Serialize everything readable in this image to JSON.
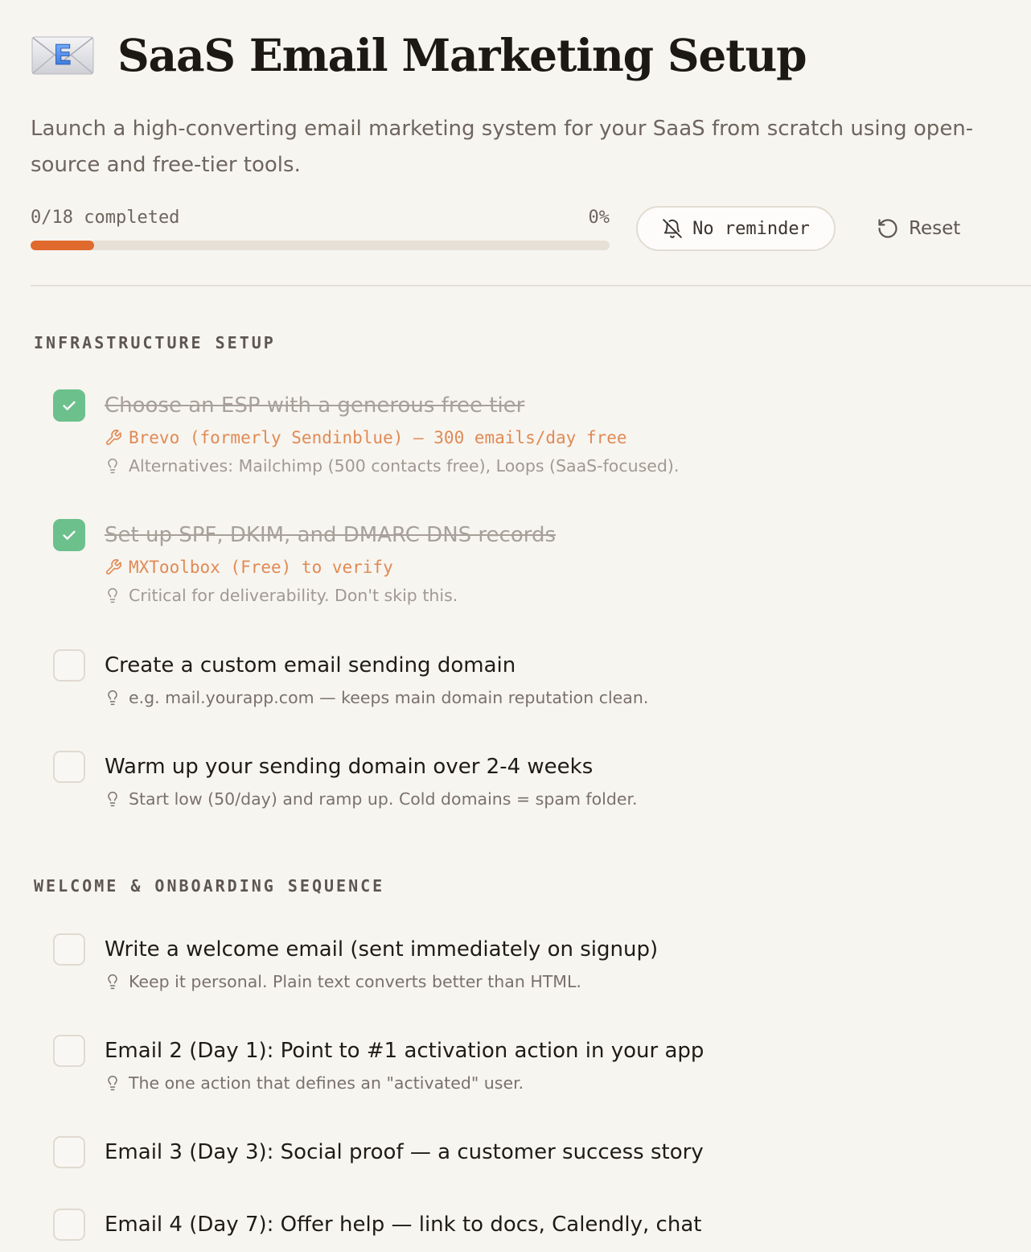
{
  "header": {
    "title": "SaaS Email Marketing Setup",
    "icon": "envelope-e-icon",
    "subtitle": "Launch a high-converting email marketing system for your SaaS from scratch using open-source and free-tier tools."
  },
  "progress": {
    "label": "0/18 completed",
    "percent_label": "0%",
    "fill_fraction": 0.11
  },
  "controls": {
    "reminder_label": "No reminder",
    "reset_label": "Reset"
  },
  "colors": {
    "accent": "#e0692d",
    "check_green": "#6cc08c",
    "tool_orange": "#e08a55",
    "background": "#f7f5f0"
  },
  "sections": [
    {
      "title": "INFRASTRUCTURE SETUP",
      "tasks": [
        {
          "title": "Choose an ESP with a generous free tier",
          "done": true,
          "tool": "Brevo (formerly Sendinblue) — 300 emails/day free",
          "tip": "Alternatives: Mailchimp (500 contacts free), Loops (SaaS-focused)."
        },
        {
          "title": "Set up SPF, DKIM, and DMARC DNS records",
          "done": true,
          "tool": "MXToolbox (Free) to verify",
          "tip": "Critical for deliverability. Don't skip this."
        },
        {
          "title": "Create a custom email sending domain",
          "done": false,
          "tip": "e.g. mail.yourapp.com — keeps main domain reputation clean."
        },
        {
          "title": "Warm up your sending domain over 2-4 weeks",
          "done": false,
          "tip": "Start low (50/day) and ramp up. Cold domains = spam folder."
        }
      ]
    },
    {
      "title": "WELCOME & ONBOARDING SEQUENCE",
      "tasks": [
        {
          "title": "Write a welcome email (sent immediately on signup)",
          "done": false,
          "tip": "Keep it personal. Plain text converts better than HTML."
        },
        {
          "title": "Email 2 (Day 1): Point to #1 activation action in your app",
          "done": false,
          "tip": "The one action that defines an \"activated\" user."
        },
        {
          "title": "Email 3 (Day 3): Social proof — a customer success story",
          "done": false
        },
        {
          "title": "Email 4 (Day 7): Offer help — link to docs, Calendly, chat",
          "done": false
        }
      ]
    }
  ]
}
